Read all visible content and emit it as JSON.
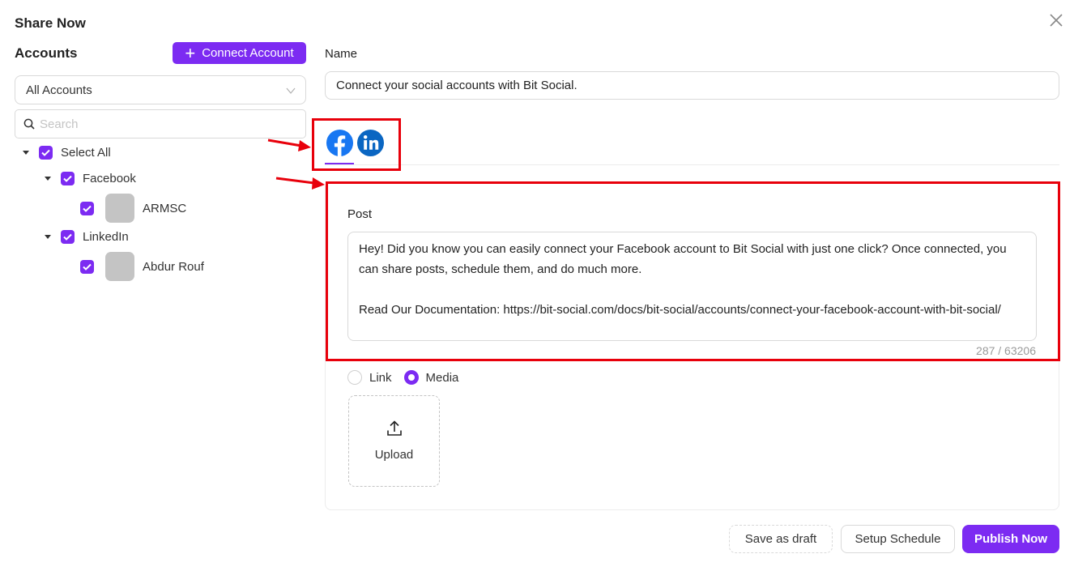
{
  "dialog": {
    "title": "Share Now"
  },
  "accounts": {
    "heading": "Accounts",
    "connect_button": "Connect Account",
    "filter_value": "All Accounts",
    "search_placeholder": "Search",
    "select_all_label": "Select All",
    "groups": [
      {
        "network": "Facebook",
        "checked": true,
        "accounts": [
          {
            "name": "ARMSC",
            "checked": true
          }
        ]
      },
      {
        "network": "LinkedIn",
        "checked": true,
        "accounts": [
          {
            "name": "Abdur Rouf",
            "checked": true
          }
        ]
      }
    ]
  },
  "form": {
    "name_label": "Name",
    "name_value": "Connect your social accounts with Bit Social.",
    "tabs": [
      {
        "network": "facebook",
        "icon": "facebook-icon",
        "color": "#1877f2",
        "active": true
      },
      {
        "network": "linkedin",
        "icon": "linkedin-icon",
        "color": "#0a66c2",
        "active": false
      }
    ],
    "post_label": "Post",
    "post_text": "Hey! Did you know you can easily connect your Facebook account to Bit Social with just one click? Once connected, you can share posts, schedule them, and do much more.\n\nRead Our Documentation: https://bit-social.com/docs/bit-social/accounts/connect-your-facebook-account-with-bit-social/",
    "char_count": "287 / 63206",
    "attachment_types": [
      {
        "label": "Link",
        "selected": false
      },
      {
        "label": "Media",
        "selected": true
      }
    ],
    "upload_label": "Upload"
  },
  "actions": {
    "save_draft": "Save as draft",
    "setup_schedule": "Setup Schedule",
    "publish_now": "Publish Now"
  },
  "colors": {
    "accent": "#7c2bf2",
    "annotation": "#e8000b"
  }
}
